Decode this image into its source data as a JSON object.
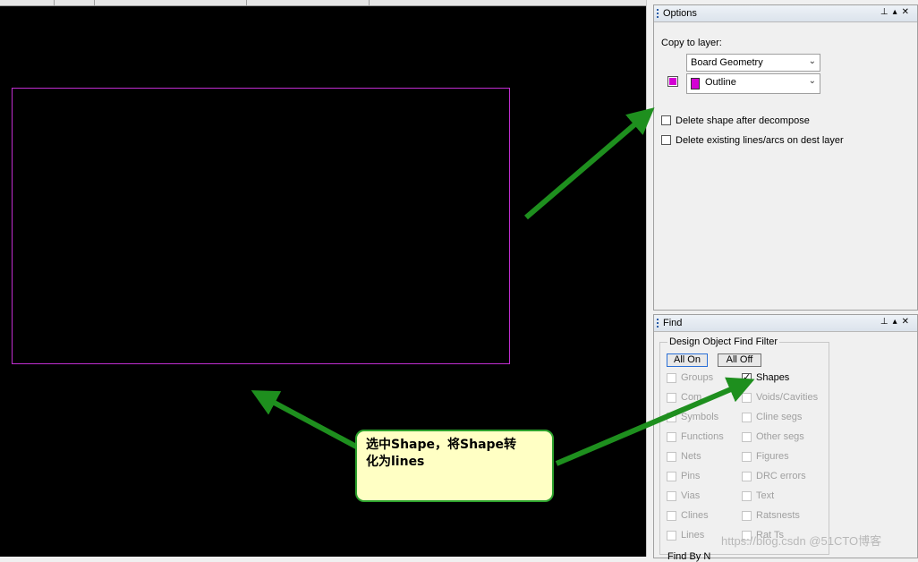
{
  "options_panel": {
    "title": "Options",
    "copy_to_layer_label": "Copy to layer:",
    "class_select": "Board Geometry",
    "subclass_select": "Outline",
    "layer_color": "#d400d4",
    "checkboxes": [
      {
        "label": "Delete shape after decompose",
        "checked": false
      },
      {
        "label": "Delete existing lines/arcs on dest layer",
        "checked": false
      }
    ]
  },
  "find_panel": {
    "title": "Find",
    "group_title": "Design Object Find Filter",
    "all_on": "All On",
    "all_off": "All Off",
    "left_items": [
      {
        "label": "Groups",
        "checked": false,
        "enabled": false
      },
      {
        "label": "Com",
        "checked": false,
        "enabled": false
      },
      {
        "label": "Symbols",
        "checked": false,
        "enabled": false
      },
      {
        "label": "Functions",
        "checked": false,
        "enabled": false
      },
      {
        "label": "Nets",
        "checked": false,
        "enabled": false
      },
      {
        "label": "Pins",
        "checked": false,
        "enabled": false
      },
      {
        "label": "Vias",
        "checked": false,
        "enabled": false
      },
      {
        "label": "Clines",
        "checked": false,
        "enabled": false
      },
      {
        "label": "Lines",
        "checked": false,
        "enabled": false
      }
    ],
    "right_items": [
      {
        "label": "Shapes",
        "checked": true,
        "enabled": true
      },
      {
        "label": "Voids/Cavities",
        "checked": false,
        "enabled": false
      },
      {
        "label": "Cline segs",
        "checked": false,
        "enabled": false
      },
      {
        "label": "Other segs",
        "checked": false,
        "enabled": false
      },
      {
        "label": "Figures",
        "checked": false,
        "enabled": false
      },
      {
        "label": "DRC errors",
        "checked": false,
        "enabled": false
      },
      {
        "label": "Text",
        "checked": false,
        "enabled": false
      },
      {
        "label": "Ratsnests",
        "checked": false,
        "enabled": false
      },
      {
        "label": "Rat Ts",
        "checked": false,
        "enabled": false
      }
    ],
    "find_by_name_partial": "Find By N"
  },
  "annotation": {
    "line1": "选中Shape，将Shape转",
    "line2": "化为lines"
  },
  "watermark": "https://blog.csdn @51CTO博客",
  "colors": {
    "canvas_bg": "#000000",
    "shape_outline": "#c02ed0",
    "arrow_green": "#1e8f1e",
    "bubble_fill": "#ffffc4"
  }
}
